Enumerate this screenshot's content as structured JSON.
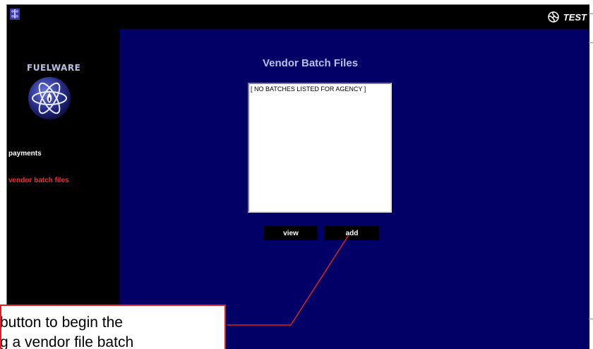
{
  "topbar": {
    "test_label": "TEST",
    "test_icon": "swirl-logo-icon",
    "corner_icon": "app-logo-icon"
  },
  "sidebar": {
    "brand": "FUELWARE",
    "logo_icon": "atom-logo-icon",
    "items": [
      {
        "label": "payments",
        "color": "#ffffff",
        "active": false
      },
      {
        "label": "vendor batch files",
        "color": "#ff2a2a",
        "active": true
      }
    ]
  },
  "main": {
    "title": "Vendor Batch Files",
    "batch_list": {
      "empty_text": "[ NO BATCHES LISTED FOR AGENCY ]"
    },
    "buttons": {
      "view_label": "view",
      "add_label": "add"
    }
  },
  "annotation": {
    "line1": "button to begin the",
    "line2": "g a vendor file batch",
    "border_color": "#e02020"
  },
  "colors": {
    "main_bg": "#000066",
    "sidebar_bg": "#000000",
    "title": "#b8c0f0",
    "active_nav": "#ff2a2a"
  }
}
